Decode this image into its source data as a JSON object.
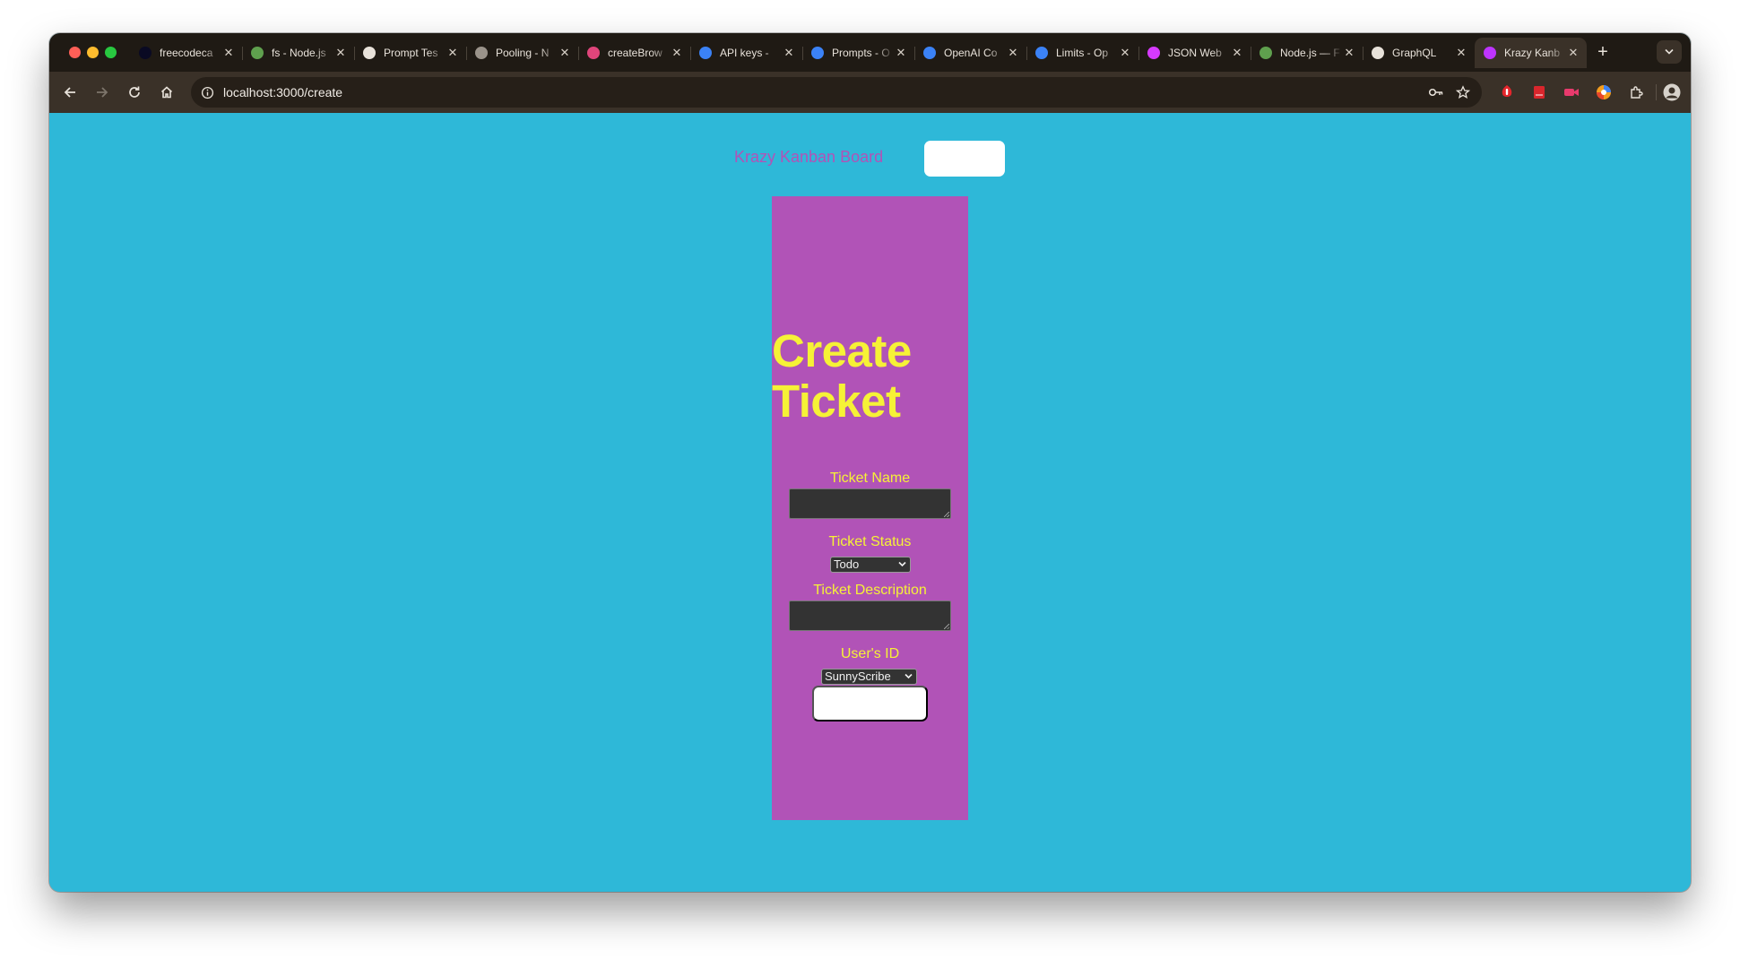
{
  "browser": {
    "tabs": [
      {
        "title": "freecodeca",
        "icon": "freecodecamp-icon",
        "color": "#0a0a23"
      },
      {
        "title": "fs - Node.js",
        "icon": "nodejs-icon",
        "color": "#5fa04e"
      },
      {
        "title": "Prompt Tes",
        "icon": "prompt-icon",
        "color": "#e8e2da"
      },
      {
        "title": "Pooling - N",
        "icon": "globe-icon",
        "color": "#9a938a"
      },
      {
        "title": "createBrow",
        "icon": "dots-icon",
        "color": "#e0457b"
      },
      {
        "title": "API keys -",
        "icon": "openai-icon",
        "color": "#3b82f6"
      },
      {
        "title": "Prompts - O",
        "icon": "openai-icon",
        "color": "#3b82f6"
      },
      {
        "title": "OpenAI Co",
        "icon": "openai-icon",
        "color": "#3b82f6"
      },
      {
        "title": "Limits - Op",
        "icon": "openai-icon",
        "color": "#3b82f6"
      },
      {
        "title": "JSON Web",
        "icon": "jwt-icon",
        "color": "#d63aff"
      },
      {
        "title": "Node.js — F",
        "icon": "nodejs-icon",
        "color": "#5fa04e"
      },
      {
        "title": "GraphQL",
        "icon": "graphql-icon",
        "color": "#e8e2da"
      },
      {
        "title": "Krazy Kanb",
        "icon": "vite-icon",
        "color": "#bd34fe",
        "active": true
      }
    ],
    "url": "localhost:3000/create"
  },
  "header": {
    "brand": "Krazy Kanban Board",
    "nav_button_label": ""
  },
  "form": {
    "title": "Create Ticket",
    "name_label": "Ticket Name",
    "name_value": "",
    "status_label": "Ticket Status",
    "status_selected": "Todo",
    "description_label": "Ticket Description",
    "description_value": "",
    "user_label": "User's ID",
    "user_selected": "SunnyScribe",
    "submit_label": ""
  },
  "colors": {
    "page_background": "#2eb8d8",
    "panel_background": "#b153b7",
    "label_text": "#f6f236",
    "brand_text": "#b153b7"
  }
}
